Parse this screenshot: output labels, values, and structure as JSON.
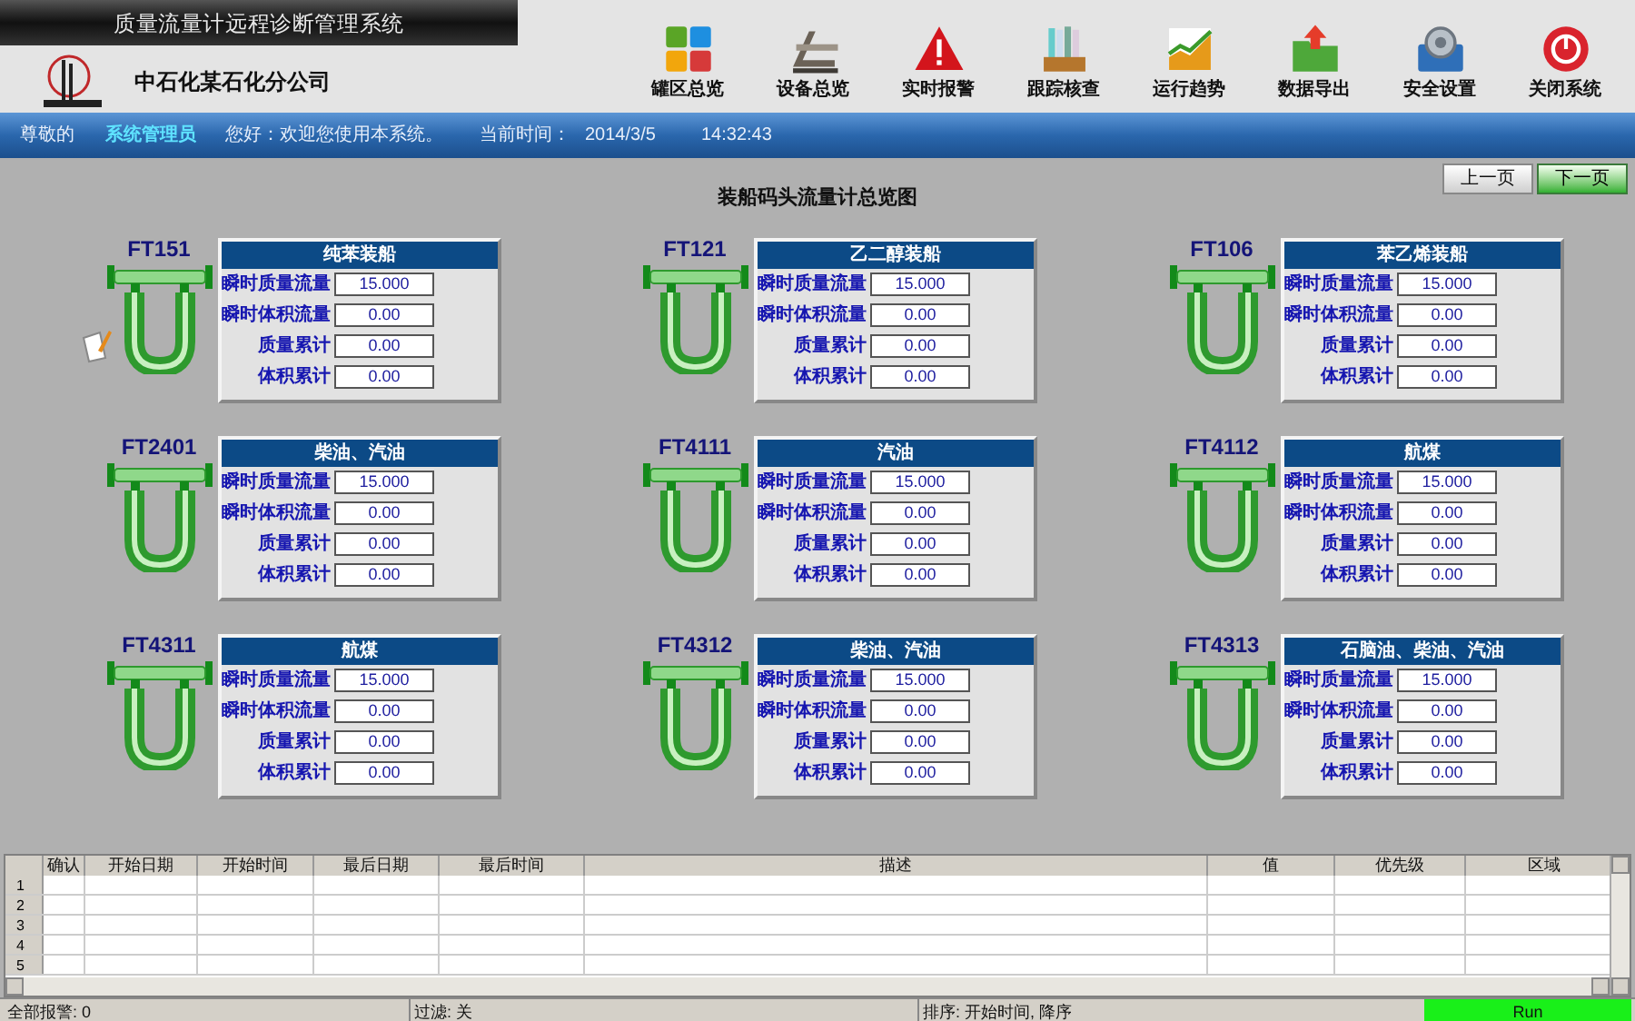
{
  "window": {
    "title": "质量流量计远程诊断管理系统"
  },
  "company": "中石化某石化分公司",
  "toolbar": [
    {
      "kind": "tiles",
      "label": "罐区总览"
    },
    {
      "kind": "equipment",
      "label": "设备总览"
    },
    {
      "kind": "alarm",
      "label": "实时报警"
    },
    {
      "kind": "books",
      "label": "跟踪核查"
    },
    {
      "kind": "trend",
      "label": "运行趋势"
    },
    {
      "kind": "export",
      "label": "数据导出"
    },
    {
      "kind": "security",
      "label": "安全设置"
    },
    {
      "kind": "power",
      "label": "关闭系统"
    }
  ],
  "info_bar": {
    "greeting": "尊敬的",
    "user": "系统管理员",
    "welcome": "您好：欢迎您使用本系统。",
    "time_label": "当前时间：",
    "date": "2014/3/5",
    "time": "14:32:43"
  },
  "page_title": "装船码头流量计总览图",
  "pager": [
    {
      "label": "上一页",
      "selected": false
    },
    {
      "label": "下一页",
      "selected": true
    }
  ],
  "meters": [
    {
      "tag": "FT151",
      "title": "纯苯装船",
      "note": true,
      "readings": [
        {
          "label": "瞬时质量流量",
          "value": "15.000"
        },
        {
          "label": "瞬时体积流量",
          "value": "0.00"
        },
        {
          "label": "质量累计",
          "value": "0.00"
        },
        {
          "label": "体积累计",
          "value": "0.00"
        }
      ]
    },
    {
      "tag": "FT121",
      "title": "乙二醇装船",
      "note": false,
      "readings": [
        {
          "label": "瞬时质量流量",
          "value": "15.000"
        },
        {
          "label": "瞬时体积流量",
          "value": "0.00"
        },
        {
          "label": "质量累计",
          "value": "0.00"
        },
        {
          "label": "体积累计",
          "value": "0.00"
        }
      ]
    },
    {
      "tag": "FT106",
      "title": "苯乙烯装船",
      "note": false,
      "readings": [
        {
          "label": "瞬时质量流量",
          "value": "15.000"
        },
        {
          "label": "瞬时体积流量",
          "value": "0.00"
        },
        {
          "label": "质量累计",
          "value": "0.00"
        },
        {
          "label": "体积累计",
          "value": "0.00"
        }
      ]
    },
    {
      "tag": "FT2401",
      "title": "柴油、汽油",
      "note": false,
      "readings": [
        {
          "label": "瞬时质量流量",
          "value": "15.000"
        },
        {
          "label": "瞬时体积流量",
          "value": "0.00"
        },
        {
          "label": "质量累计",
          "value": "0.00"
        },
        {
          "label": "体积累计",
          "value": "0.00"
        }
      ]
    },
    {
      "tag": "FT4111",
      "title": "汽油",
      "note": false,
      "readings": [
        {
          "label": "瞬时质量流量",
          "value": "15.000"
        },
        {
          "label": "瞬时体积流量",
          "value": "0.00"
        },
        {
          "label": "质量累计",
          "value": "0.00"
        },
        {
          "label": "体积累计",
          "value": "0.00"
        }
      ]
    },
    {
      "tag": "FT4112",
      "title": "航煤",
      "note": false,
      "readings": [
        {
          "label": "瞬时质量流量",
          "value": "15.000"
        },
        {
          "label": "瞬时体积流量",
          "value": "0.00"
        },
        {
          "label": "质量累计",
          "value": "0.00"
        },
        {
          "label": "体积累计",
          "value": "0.00"
        }
      ]
    },
    {
      "tag": "FT4311",
      "title": "航煤",
      "note": false,
      "readings": [
        {
          "label": "瞬时质量流量",
          "value": "15.000"
        },
        {
          "label": "瞬时体积流量",
          "value": "0.00"
        },
        {
          "label": "质量累计",
          "value": "0.00"
        },
        {
          "label": "体积累计",
          "value": "0.00"
        }
      ]
    },
    {
      "tag": "FT4312",
      "title": "柴油、汽油",
      "note": false,
      "readings": [
        {
          "label": "瞬时质量流量",
          "value": "15.000"
        },
        {
          "label": "瞬时体积流量",
          "value": "0.00"
        },
        {
          "label": "质量累计",
          "value": "0.00"
        },
        {
          "label": "体积累计",
          "value": "0.00"
        }
      ]
    },
    {
      "tag": "FT4313",
      "title": "石脑油、柴油、汽油",
      "note": false,
      "readings": [
        {
          "label": "瞬时质量流量",
          "value": "15.000"
        },
        {
          "label": "瞬时体积流量",
          "value": "0.00"
        },
        {
          "label": "质量累计",
          "value": "0.00"
        },
        {
          "label": "体积累计",
          "value": "0.00"
        }
      ]
    }
  ],
  "alarm_table": {
    "columns": [
      "确认",
      "开始日期",
      "开始时间",
      "最后日期",
      "最后时间",
      "描述",
      "值",
      "优先级",
      "区域"
    ],
    "rows": [
      "1",
      "2",
      "3",
      "4",
      "5"
    ]
  },
  "status_bar": {
    "total": "全部报警: 0",
    "filter": "过滤: 关",
    "sort": "排序: 开始时间, 降序",
    "run": "Run"
  }
}
